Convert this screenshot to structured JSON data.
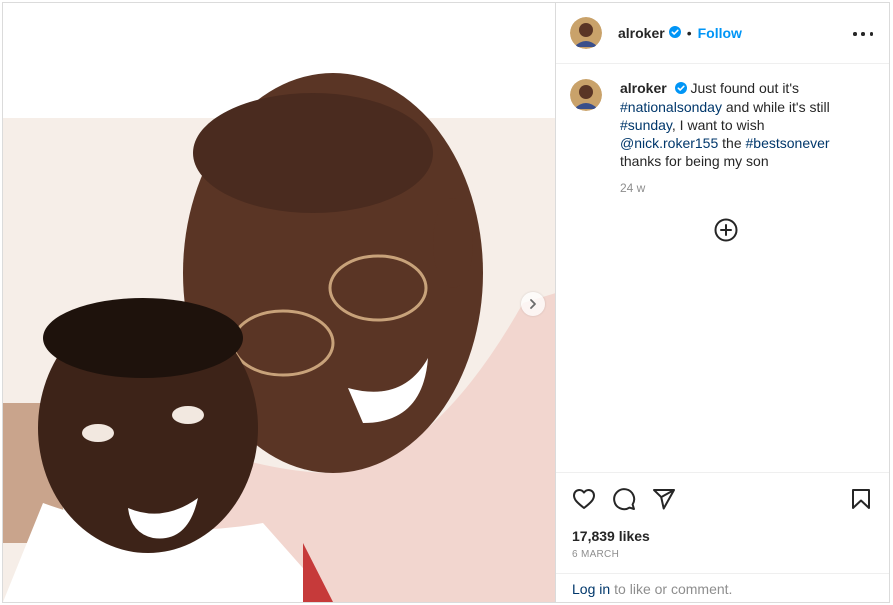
{
  "post": {
    "username": "alroker",
    "follow_label": "Follow",
    "separator": "•",
    "caption_parts": [
      {
        "text": "Just found out it's ",
        "kind": "text"
      },
      {
        "text": "#nationalsonday",
        "kind": "tag"
      },
      {
        "text": " and while it's still ",
        "kind": "text"
      },
      {
        "text": "#sunday",
        "kind": "tag"
      },
      {
        "text": ", I want to wish ",
        "kind": "text"
      },
      {
        "text": "@nick.roker155",
        "kind": "tag"
      },
      {
        "text": " the ",
        "kind": "text"
      },
      {
        "text": "#bestsonever",
        "kind": "tag"
      },
      {
        "text": " thanks for being my son",
        "kind": "text"
      }
    ],
    "age": "24 w",
    "likes": "17,839 likes",
    "date": "6 MARCH",
    "login_label": "Log in",
    "login_suffix": "to like or comment."
  },
  "icons": {
    "verified": "verified-badge-icon",
    "more": "more-options-icon",
    "add_comment": "plus-circle-icon",
    "like": "heart-icon",
    "comment": "comment-icon",
    "share": "send-icon",
    "save": "bookmark-icon",
    "next": "chevron-right-icon"
  },
  "colors": {
    "accent": "#0095f6",
    "link": "#00376b",
    "muted": "#8e8e8e",
    "text": "#262626"
  }
}
